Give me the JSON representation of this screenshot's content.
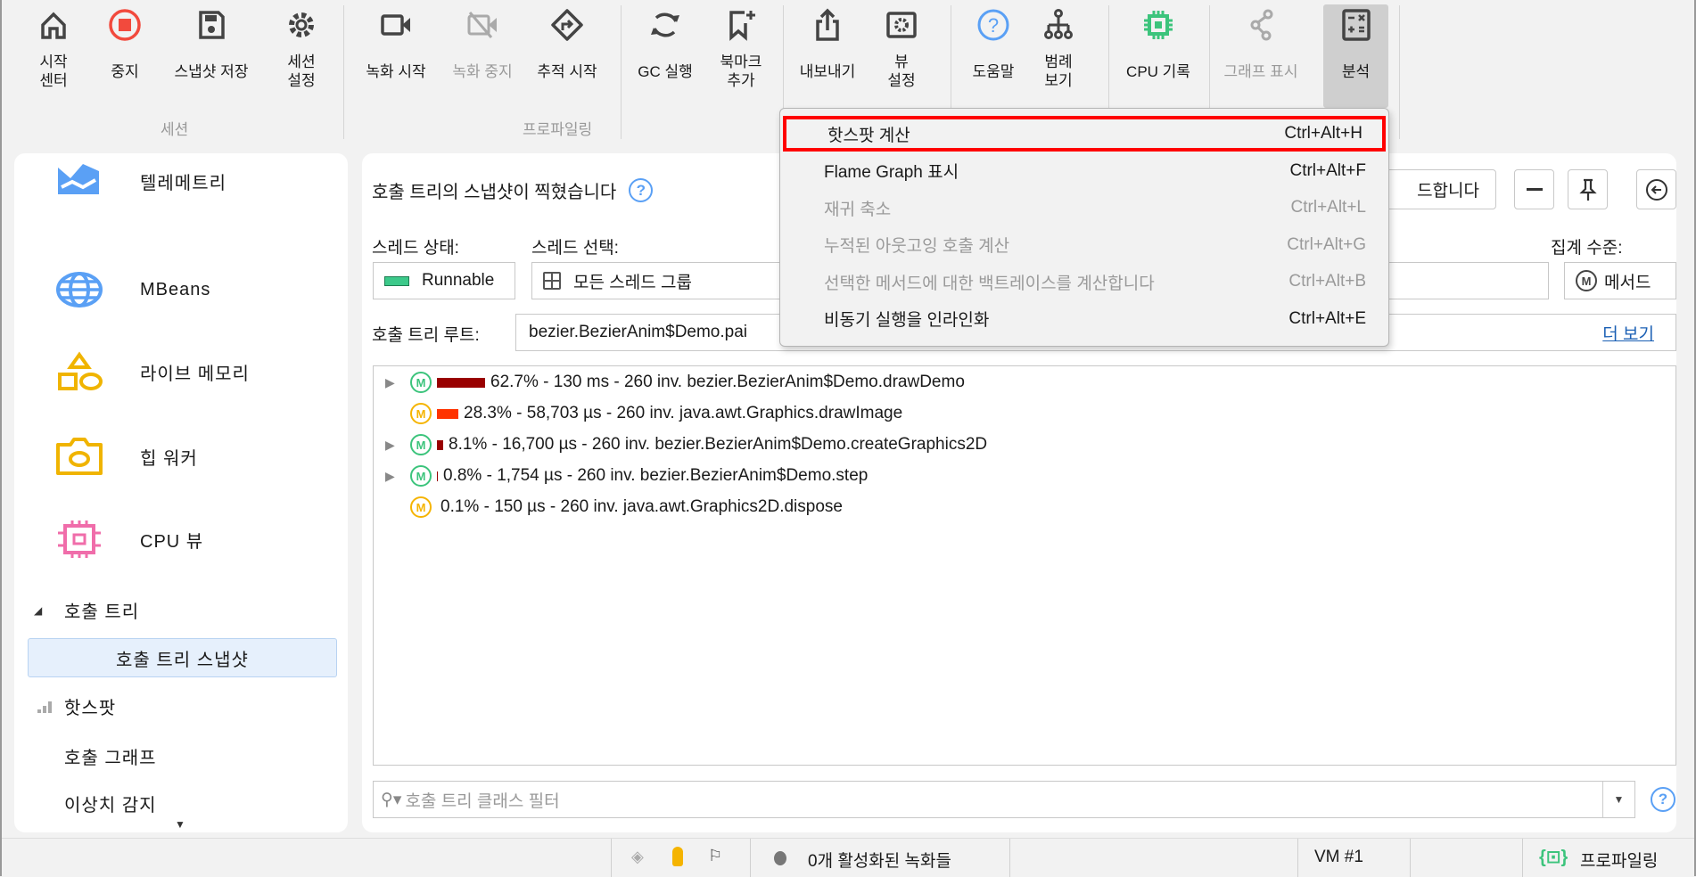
{
  "toolbar": {
    "groups": [
      {
        "label": "세션"
      },
      {
        "label": "프로파일링"
      }
    ],
    "buttons": [
      {
        "label": "시작\n센터",
        "icon": "home-icon"
      },
      {
        "label": "중지",
        "icon": "stop-icon"
      },
      {
        "label": "스냅샷 저장",
        "icon": "save-icon"
      },
      {
        "label": "세션\n설정",
        "icon": "gear-icon"
      },
      {
        "label": "녹화 시작",
        "icon": "video-icon"
      },
      {
        "label": "녹화 중지",
        "icon": "video-off-icon"
      },
      {
        "label": "추적 시작",
        "icon": "trace-icon"
      },
      {
        "label": "GC 실행",
        "icon": "refresh-icon"
      },
      {
        "label": "북마크\n추가",
        "icon": "bookmark-add-icon"
      },
      {
        "label": "내보내기",
        "icon": "export-icon"
      },
      {
        "label": "뷰\n설정",
        "icon": "view-settings-icon"
      },
      {
        "label": "도움말",
        "icon": "help-icon"
      },
      {
        "label": "범례\n보기",
        "icon": "legend-icon"
      },
      {
        "label": "CPU 기록",
        "icon": "cpu-icon"
      },
      {
        "label": "그래프 표시",
        "icon": "graph-icon"
      },
      {
        "label": "분석",
        "icon": "calculator-icon"
      }
    ]
  },
  "sidebar": {
    "items": [
      {
        "label": "텔레메트리"
      },
      {
        "label": "MBeans"
      },
      {
        "label": "라이브 메모리"
      },
      {
        "label": "힙 워커"
      },
      {
        "label": "CPU 뷰"
      }
    ],
    "tree": {
      "parent": "호출 트리",
      "selected": "호출 트리 스냅샷",
      "others": [
        "핫스팟",
        "호출 그래프",
        "이상치 감지"
      ]
    }
  },
  "main": {
    "title": "호출 트리의 스냅샷이 찍혔습니다",
    "reload_button": "드합니다",
    "thread_state_label": "스레드 상태:",
    "thread_state_value": "Runnable",
    "thread_select_label": "스레드 선택:",
    "thread_select_value": "모든 스레드 그룹",
    "aggregation_label": "집계 수준:",
    "aggregation_value": "메서드",
    "root_label": "호출 트리 루트:",
    "root_value": "bezier.BezierAnim$Demo.pai",
    "more_link": "더 보기",
    "rows": [
      {
        "text": "62.7% - 130 ms - 260 inv. bezier.BezierAnim$Demo.drawDemo",
        "expandable": true,
        "icon_color": "#3cc47c",
        "bar_color": "#990000",
        "bar_fraction": 0.627
      },
      {
        "text": "28.3% - 58,703 µs - 260 inv. java.awt.Graphics.drawImage",
        "expandable": false,
        "icon_color": "#f5b400",
        "bar_color": "#ff3300",
        "bar_fraction": 0.283
      },
      {
        "text": "8.1% - 16,700 µs - 260 inv. bezier.BezierAnim$Demo.createGraphics2D",
        "expandable": true,
        "icon_color": "#3cc47c",
        "bar_color": "#990000",
        "bar_fraction": 0.081
      },
      {
        "text": "0.8% - 1,754 µs - 260 inv. bezier.BezierAnim$Demo.step",
        "expandable": true,
        "icon_color": "#3cc47c",
        "bar_color": "#990000",
        "bar_fraction": 0.008
      },
      {
        "text": "0.1% - 150 µs - 260 inv. java.awt.Graphics2D.dispose",
        "expandable": false,
        "icon_color": "#f5b400",
        "bar_color": "#990000",
        "bar_fraction": 0.001
      }
    ],
    "method_icon_letter": "M",
    "filter_placeholder": "호출 트리 클래스 필터"
  },
  "menu": {
    "items": [
      {
        "label": "핫스팟 계산",
        "shortcut": "Ctrl+Alt+H",
        "enabled": true,
        "highlighted": true
      },
      {
        "label": "Flame Graph 표시",
        "shortcut": "Ctrl+Alt+F",
        "enabled": true
      },
      {
        "label": "재귀 축소",
        "shortcut": "Ctrl+Alt+L",
        "enabled": false
      },
      {
        "label": "누적된 아웃고잉 호출 계산",
        "shortcut": "Ctrl+Alt+G",
        "enabled": false
      },
      {
        "label": "선택한 메서드에 대한 백트레이스를 계산합니다",
        "shortcut": "Ctrl+Alt+B",
        "enabled": false
      },
      {
        "label": "비동기 실행을 인라인화",
        "shortcut": "Ctrl+Alt+E",
        "enabled": true
      }
    ]
  },
  "status": {
    "recordings": "0개 활성화된 녹화들",
    "vm": "VM #1",
    "mode": "프로파일링"
  }
}
